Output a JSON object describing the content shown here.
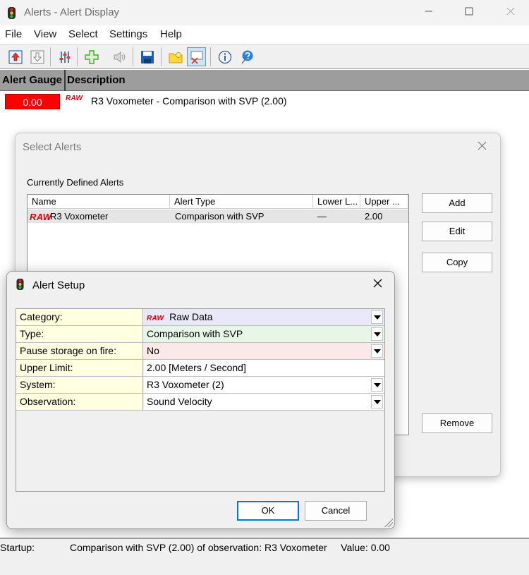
{
  "window": {
    "title": "Alerts - Alert Display"
  },
  "menu": [
    "File",
    "View",
    "Select",
    "Settings",
    "Help"
  ],
  "toolbar": {
    "icons": [
      "upload-icon",
      "download-icon",
      "sliders-icon",
      "add-icon",
      "speaker-icon",
      "save-icon",
      "folder-icon",
      "clear-selection-icon",
      "info-icon",
      "help-icon"
    ],
    "pressed": "clear-selection-icon"
  },
  "alerts_table": {
    "columns": [
      "Alert Gauge",
      "Description"
    ],
    "rows": [
      {
        "gauge": "0.00",
        "badge": "RAW",
        "description": "R3 Voxometer - Comparison with SVP (2.00)"
      }
    ]
  },
  "select_alerts": {
    "title": "Select Alerts",
    "group_label": "Currently Defined Alerts",
    "columns": [
      "Name",
      "Alert Type",
      "Lower L...",
      "Upper ..."
    ],
    "rows": [
      {
        "badge": "RAW",
        "name": "R3 Voxometer",
        "type": "Comparison with SVP",
        "lower": "—",
        "upper": "2.00"
      }
    ],
    "buttons": {
      "add": "Add",
      "edit": "Edit",
      "copy": "Copy",
      "remove": "Remove"
    }
  },
  "alert_setup": {
    "title": "Alert Setup",
    "properties": [
      {
        "label": "Category:",
        "value": "Raw Data",
        "badge": "RAW",
        "color": "#e8e8f8",
        "dropdown": true
      },
      {
        "label": "Type:",
        "value": "Comparison with SVP",
        "color": "#e8f6e8",
        "dropdown": true
      },
      {
        "label": "Pause storage on fire:",
        "value": "No",
        "color": "#fbe8e8",
        "dropdown": true
      },
      {
        "label": "Upper Limit:",
        "value": "2.00 [Meters / Second]",
        "color": "#ffffff",
        "dropdown": false
      },
      {
        "label": "System:",
        "value": "R3 Voxometer (2)",
        "color": "#ffffff",
        "dropdown": true
      },
      {
        "label": "Observation:",
        "value": "Sound Velocity",
        "color": "#ffffff",
        "dropdown": true
      }
    ],
    "buttons": {
      "ok": "OK",
      "cancel": "Cancel"
    }
  },
  "status": {
    "label": "Startup:",
    "message": "Comparison with SVP (2.00) of observation: R3 Voxometer     Value: 0.00"
  },
  "colors": {
    "alarm": "#ff0000",
    "raw_badge": "#d40000",
    "header_gray": "#9d9d9d"
  }
}
